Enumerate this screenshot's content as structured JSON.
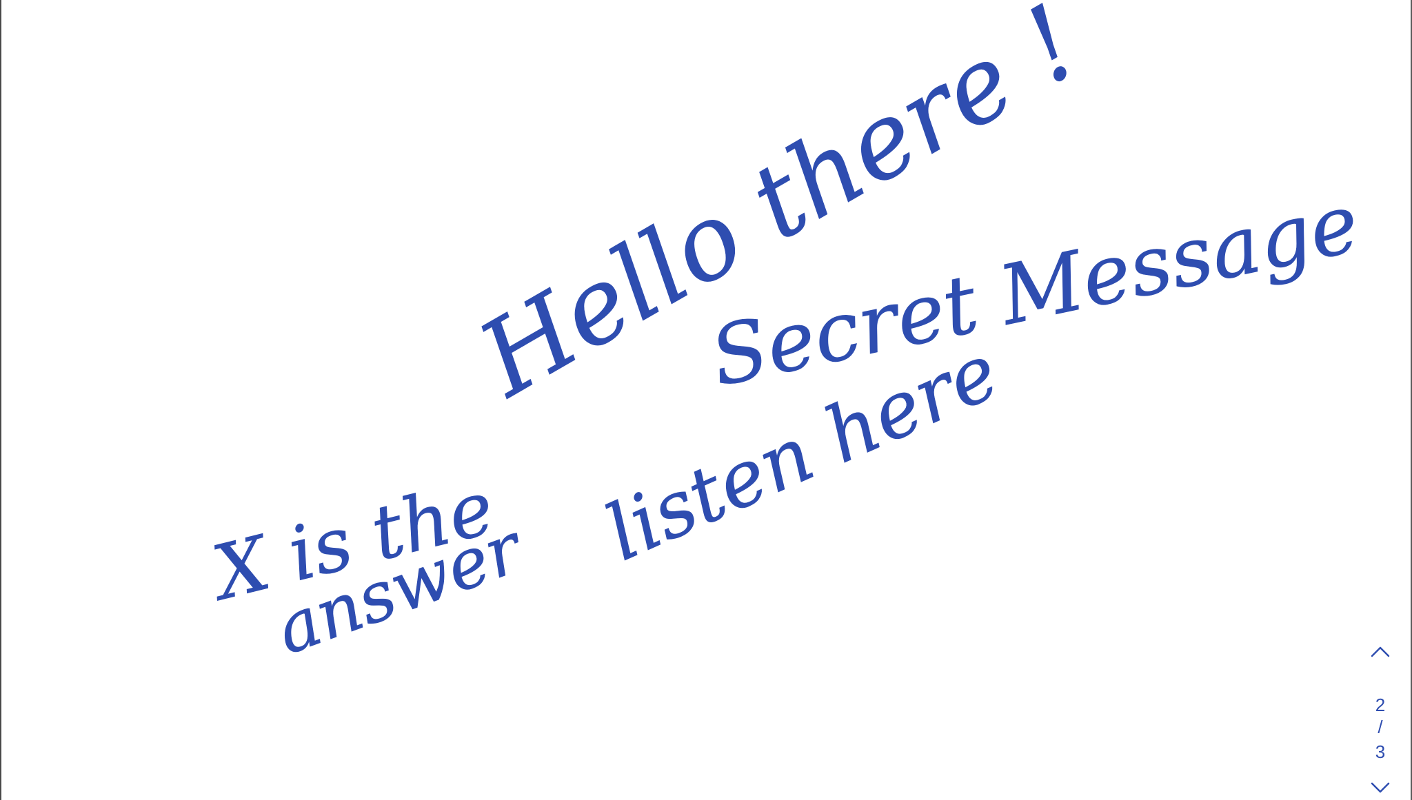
{
  "canvas": {
    "ink_color": "#2e4db0",
    "background": "#ffffff"
  },
  "notes": [
    {
      "key": "hello",
      "text": "Hello there !"
    },
    {
      "key": "secret",
      "text": "Secret Message"
    },
    {
      "key": "listen",
      "text": "listen here"
    },
    {
      "key": "x_answer_line1",
      "text": "X is the"
    },
    {
      "key": "x_answer_line2",
      "text": "answer"
    }
  ],
  "pager": {
    "current_page": "2",
    "separator": "/",
    "total_pages": "3",
    "up_icon": "chevron-up-icon",
    "down_icon": "chevron-down-icon"
  }
}
